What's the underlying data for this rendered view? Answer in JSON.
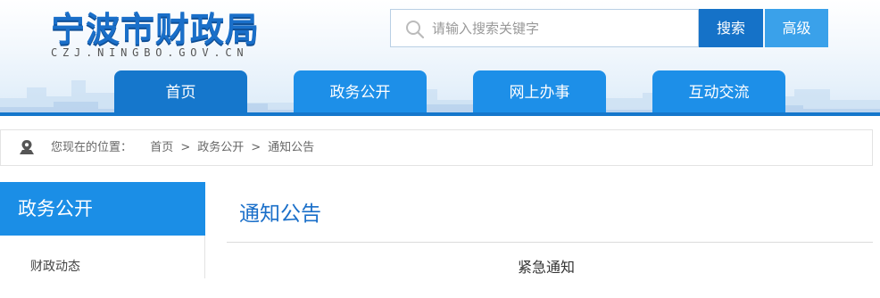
{
  "header": {
    "site_title": "宁波市财政局",
    "site_url": "CZJ.NINGBO.GOV.CN"
  },
  "search": {
    "placeholder": "请输入搜索关键字",
    "search_label": "搜索",
    "advanced_label": "高级"
  },
  "nav": {
    "items": [
      {
        "label": "首页",
        "active": true
      },
      {
        "label": "政务公开",
        "active": false
      },
      {
        "label": "网上办事",
        "active": false
      },
      {
        "label": "互动交流",
        "active": false
      }
    ]
  },
  "breadcrumb": {
    "prefix": "您现在的位置：",
    "items": [
      "首页",
      "政务公开",
      "通知公告"
    ],
    "separator": ">"
  },
  "sidebar": {
    "title": "政务公开",
    "items": [
      {
        "label": "财政动态"
      }
    ]
  },
  "main": {
    "section_title": "通知公告",
    "article_title": "紧急通知"
  },
  "colors": {
    "primary": "#1577cc",
    "nav_blue": "#1d8fe8",
    "sidebar_blue": "#1b8ee6",
    "advanced_blue": "#3aa1ea",
    "title_blue": "#1a6fc9"
  },
  "icons": {
    "search": "search-icon",
    "location": "location-pin-icon"
  }
}
